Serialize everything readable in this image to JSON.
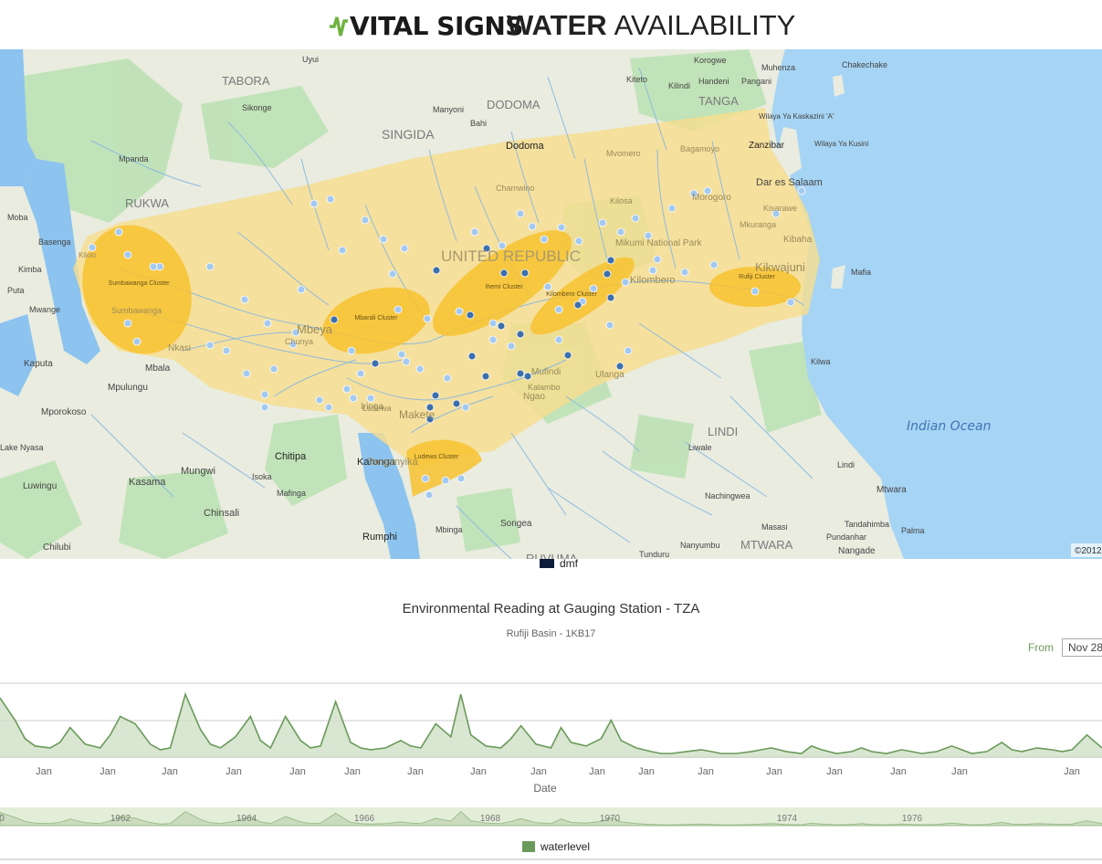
{
  "header": {
    "brand": "VITAL SIGNS",
    "title_bold": "WATER",
    "title_rest": "AVAILABILITY"
  },
  "map": {
    "attribution": "©2012",
    "colors": {
      "land": "#e9ecdf",
      "ocean": "#a6d4f4",
      "lake": "#8cc3ef",
      "park": "#bde2b5",
      "basin": "#f7dd8c",
      "cluster": "#f7c230",
      "station_light": "#a4c9f0",
      "station_dark": "#3d6fab",
      "river": "#86b6e2"
    },
    "clusters": [
      {
        "name": "Sumbawanga Cluster"
      },
      {
        "name": "Mbarali Cluster"
      },
      {
        "name": "Ihemi Cluster"
      },
      {
        "name": "Kilombero Cluster"
      },
      {
        "name": "Rufiji Cluster"
      },
      {
        "name": "Ludewa Cluster"
      }
    ],
    "places": [
      "TABORA",
      "Uyui",
      "Sikonge",
      "SINGIDA",
      "Manyoni",
      "Bahi",
      "DODOMA",
      "Dodoma",
      "Kiteto",
      "Kilindi",
      "Handeni",
      "Pangani",
      "TANGA",
      "Korogwe",
      "Muhenza",
      "Chakechake",
      "Wilaya Ya Kaskazini 'A'",
      "Zanzibar",
      "Wilaya Ya Kusini",
      "Dar es Salaam",
      "Mpanda",
      "RUKWA",
      "Mafia",
      "Kilwa",
      "Indian Ocean",
      "LINDI",
      "Liwale",
      "Lindi",
      "Mtwara",
      "Nachingwea",
      "Masasi",
      "Tandahimba",
      "Palma",
      "Pundanhar",
      "Nangade",
      "MTWARA",
      "Nanyumbu",
      "Tunduru",
      "RUVUMA",
      "Songea",
      "Mbinga",
      "Rumphi",
      "Karonga",
      "Chitipa",
      "Isoka",
      "Mafinga",
      "Mungwi",
      "Kasama",
      "Luwingu",
      "Chinsali",
      "Chilubi",
      "Mporokoso",
      "Mpulungu",
      "Mbala",
      "Kaputa",
      "Mwange",
      "Puta",
      "Kimba",
      "Moba",
      "Basenga",
      "Iringa",
      "Morogoro",
      "Mvomero",
      "Kilosa",
      "Chamwino",
      "Mikumi National Park",
      "Kilombero",
      "Ulanga",
      "Mbeya",
      "Chunya",
      "Ludewa",
      "Makete",
      "UNITED REPUBLIC",
      "Kibaha",
      "Bagamoyo",
      "Mkuranga",
      "Kisarawe",
      "Ngao",
      "Kikwajuni",
      "Nkasi",
      "Sumbawanga",
      "Kalambo",
      "Mufindi",
      "Kilolo",
      "Tanganyika",
      "Lake Nyasa",
      "Lwa"
    ]
  },
  "dmf_legend": "dmf",
  "chart": {
    "title": "Environmental Reading at Gauging Station - TZA",
    "subtitle": "Rufiji Basin - 1KB17",
    "from_label": "From",
    "from_value": "Nov 28",
    "x_axis_label": "Date",
    "legend": "waterlevel",
    "line_color": "#6a9a5a",
    "x_ticks": [
      "Jan",
      "Jan",
      "Jan",
      "Jan",
      "Jan",
      "Jan",
      "Jan",
      "Jan",
      "Jan",
      "Jan",
      "Jan",
      "Jan",
      "Jan",
      "Jan",
      "Jan",
      "Jan",
      "Jan"
    ],
    "navigator_ticks": [
      "0",
      "1962",
      "1964",
      "1966",
      "1968",
      "1970",
      "1974",
      "1976"
    ]
  },
  "chart_data": {
    "type": "area",
    "title": "Environmental Reading at Gauging Station - TZA",
    "subtitle": "Rufiji Basin - 1KB17",
    "xlabel": "Date",
    "ylabel": "",
    "series": [
      {
        "name": "waterlevel",
        "x": [
          1958.0,
          1958.3,
          1958.5,
          1958.7,
          1959.0,
          1959.2,
          1959.4,
          1959.7,
          1960.0,
          1960.2,
          1960.4,
          1960.7,
          1961.0,
          1961.2,
          1961.4,
          1961.7,
          1962.0,
          1962.2,
          1962.4,
          1962.7,
          1963.0,
          1963.2,
          1963.4,
          1963.7,
          1964.0,
          1964.2,
          1964.4,
          1964.7,
          1965.0,
          1965.2,
          1965.4,
          1965.7,
          1966.0,
          1966.2,
          1966.4,
          1966.7,
          1967.0,
          1967.2,
          1967.4,
          1967.7,
          1968.0,
          1968.2,
          1968.4,
          1968.7,
          1969.0,
          1969.2,
          1969.4,
          1969.7,
          1970.0,
          1970.2,
          1970.4,
          1970.7,
          1971.0,
          1971.2,
          1971.4,
          1971.7,
          1972.0,
          1972.2,
          1972.4,
          1972.7,
          1973.0,
          1973.2,
          1973.4,
          1973.7,
          1974.0,
          1974.2,
          1974.4,
          1974.7,
          1975.0,
          1975.2,
          1975.4,
          1975.7,
          1976.0,
          1976.2,
          1976.4,
          1976.7,
          1977.0,
          1977.2,
          1977.4,
          1977.7,
          1978.0,
          1978.2,
          1978.4,
          1978.7,
          1979.0,
          1979.2,
          1979.4,
          1979.7,
          1980.0
        ],
        "y": [
          3.2,
          2.0,
          1.0,
          0.6,
          0.5,
          0.8,
          1.6,
          0.7,
          0.5,
          1.2,
          2.2,
          1.8,
          0.7,
          0.4,
          0.5,
          3.4,
          1.5,
          0.7,
          0.5,
          1.1,
          2.2,
          0.9,
          0.5,
          2.2,
          0.9,
          0.5,
          0.6,
          3.0,
          0.8,
          0.5,
          0.4,
          0.5,
          0.9,
          0.6,
          0.5,
          1.8,
          1.1,
          3.4,
          1.2,
          0.6,
          0.5,
          1.0,
          1.7,
          0.7,
          0.5,
          1.6,
          0.8,
          0.6,
          1.0,
          2.0,
          0.9,
          0.5,
          0.3,
          0.2,
          0.2,
          0.3,
          0.4,
          0.3,
          0.2,
          0.2,
          0.3,
          0.4,
          0.5,
          0.3,
          0.2,
          0.6,
          0.4,
          0.2,
          0.3,
          0.5,
          0.3,
          0.2,
          0.4,
          0.3,
          0.2,
          0.3,
          0.6,
          0.4,
          0.2,
          0.3,
          0.8,
          0.4,
          0.3,
          0.5,
          0.4,
          0.3,
          0.4,
          1.2,
          0.5
        ]
      }
    ],
    "grid": true,
    "legend_position": "bottom"
  }
}
